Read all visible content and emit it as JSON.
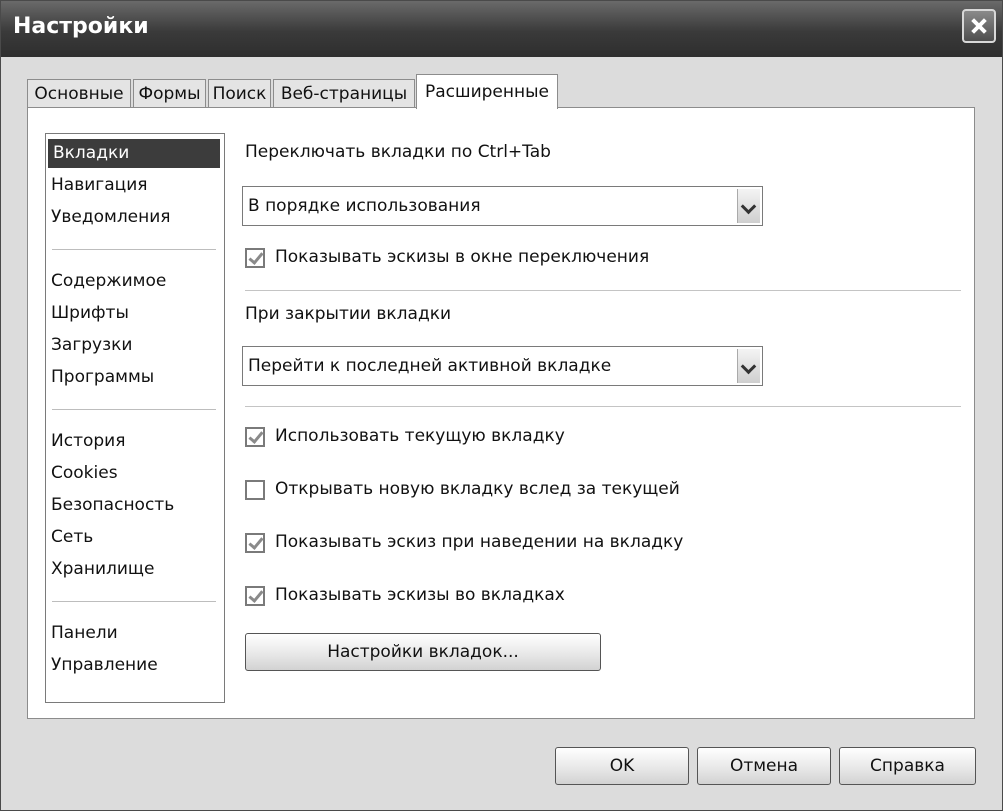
{
  "window": {
    "title": "Настройки"
  },
  "tabs": [
    {
      "label": "Основные"
    },
    {
      "label": "Формы"
    },
    {
      "label": "Поиск"
    },
    {
      "label": "Веб-страницы"
    },
    {
      "label": "Расширенные"
    }
  ],
  "sidebar": {
    "items": [
      {
        "label": "Вкладки"
      },
      {
        "label": "Навигация"
      },
      {
        "label": "Уведомления"
      },
      {
        "label": "Содержимое"
      },
      {
        "label": "Шрифты"
      },
      {
        "label": "Загрузки"
      },
      {
        "label": "Программы"
      },
      {
        "label": "История"
      },
      {
        "label": "Cookies"
      },
      {
        "label": "Безопасность"
      },
      {
        "label": "Сеть"
      },
      {
        "label": "Хранилище"
      },
      {
        "label": "Панели"
      },
      {
        "label": "Управление"
      }
    ],
    "selected": "Вкладки"
  },
  "content": {
    "ctrl_tab_label": "Переключать вкладки по Ctrl+Tab",
    "ctrl_tab_value": "В порядке использования",
    "show_thumbs_switch": {
      "label": "Показывать эскизы в окне переключения",
      "checked": true
    },
    "on_close_label": "При закрытии вкладки",
    "on_close_value": "Перейти к последней активной вкладке",
    "use_current_tab": {
      "label": "Использовать текущую вкладку",
      "checked": true
    },
    "open_after_current": {
      "label": "Открывать новую вкладку вслед за текущей",
      "checked": false
    },
    "thumb_on_hover": {
      "label": "Показывать эскиз при наведении на вкладку",
      "checked": true
    },
    "thumbs_in_tabs": {
      "label": "Показывать эскизы во вкладках",
      "checked": true
    },
    "tab_settings_button": "Настройки вкладок..."
  },
  "footer": {
    "ok": "OK",
    "cancel": "Отмена",
    "help": "Справка"
  }
}
